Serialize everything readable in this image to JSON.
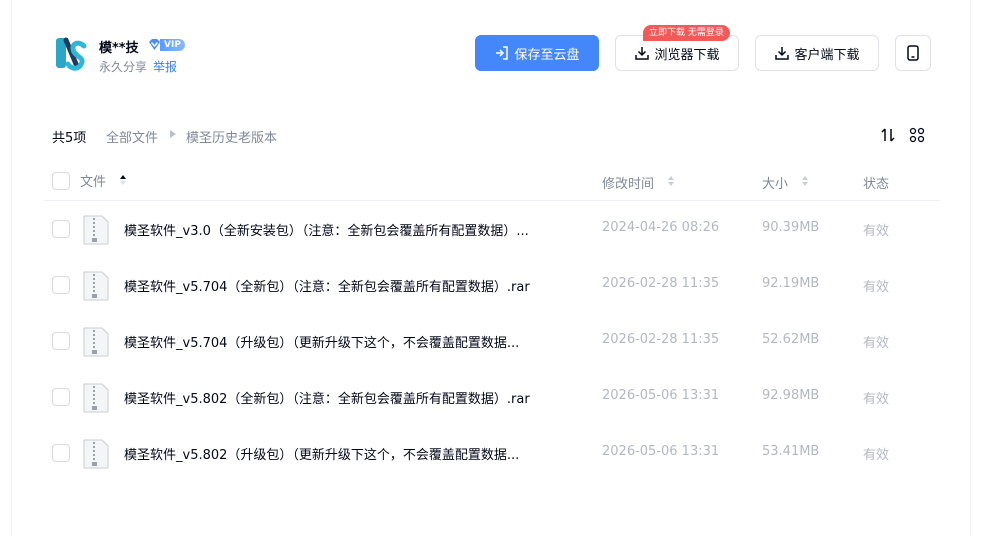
{
  "owner": {
    "name": "模**技",
    "vip_label": "VIP",
    "share_type": "永久分享",
    "report_label": "举报"
  },
  "actions": {
    "save_label": "保存至云盘",
    "browser_download_label": "浏览器下载",
    "client_download_label": "客户端下载",
    "promo_tag": "立即下载 无需登录"
  },
  "breadcrumb": {
    "count": "共5项",
    "root": "全部文件",
    "current": "模圣历史老版本"
  },
  "columns": {
    "name": "文件",
    "time": "修改时间",
    "size": "大小",
    "status": "状态"
  },
  "files": [
    {
      "name": "模圣软件_v3.0（全新安装包）（注意：全新包会覆盖所有配置数据）...",
      "time": "2024-04-26 08:26",
      "size": "90.39MB",
      "status": "有效"
    },
    {
      "name": "模圣软件_v5.704（全新包）（注意：全新包会覆盖所有配置数据）.rar",
      "time": "2026-02-28 11:35",
      "size": "92.19MB",
      "status": "有效"
    },
    {
      "name": "模圣软件_v5.704（升级包）（更新升级下这个，不会覆盖配置数据...",
      "time": "2026-02-28 11:35",
      "size": "52.62MB",
      "status": "有效"
    },
    {
      "name": "模圣软件_v5.802（全新包）（注意：全新包会覆盖所有配置数据）.rar",
      "time": "2026-05-06 13:31",
      "size": "92.98MB",
      "status": "有效"
    },
    {
      "name": "模圣软件_v5.802（升级包）（更新升级下这个，不会覆盖配置数据...",
      "time": "2026-05-06 13:31",
      "size": "53.41MB",
      "status": "有效"
    }
  ],
  "colors": {
    "primary": "#4387fa",
    "link": "#3b7cf5",
    "promo": "#f25a5a",
    "muted": "#b3b8c2"
  }
}
